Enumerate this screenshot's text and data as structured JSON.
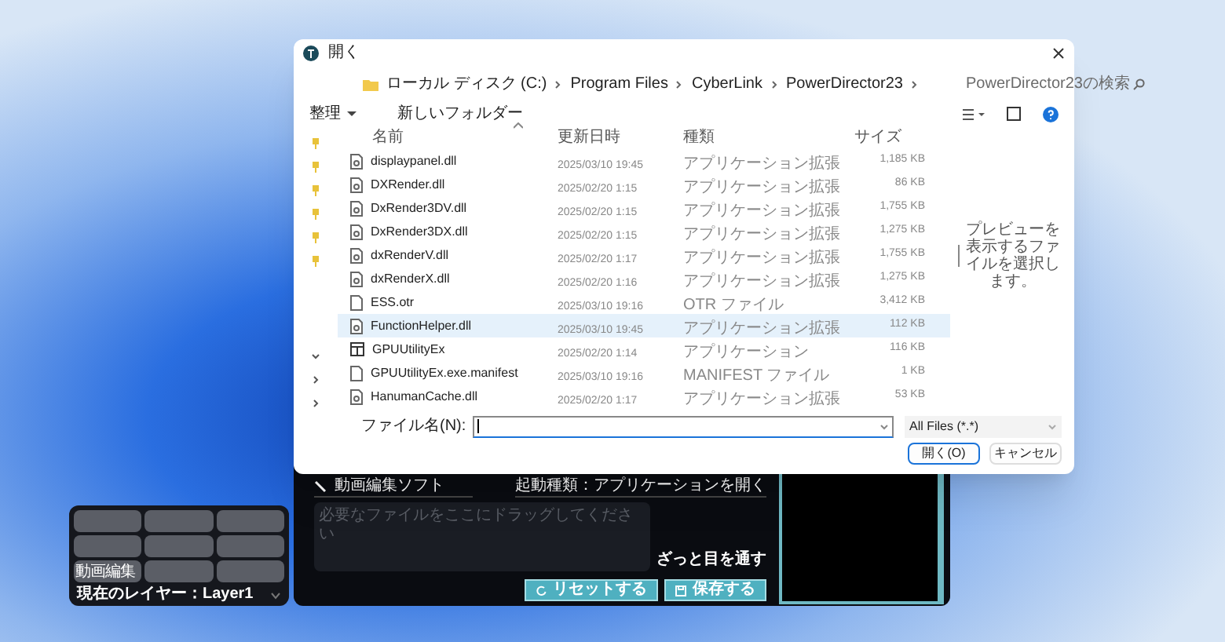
{
  "dialog": {
    "title": "開く",
    "path": [
      "ローカル ディスク (C:)",
      "Program Files",
      "CyberLink",
      "PowerDirector23"
    ],
    "search_placeholder": "PowerDirector23の検索",
    "toolbar": {
      "organize": "整理",
      "new_folder": "新しいフォルダー"
    },
    "columns": [
      "名前",
      "更新日時",
      "種類",
      "サイズ"
    ],
    "files": [
      {
        "name": "displaypanel.dll",
        "date": "2025/03/10 19:45",
        "type": "アプリケーション拡張",
        "size": "1,185 KB",
        "kind": "dll",
        "highlighted": false
      },
      {
        "name": "DXRender.dll",
        "date": "2025/02/20 1:15",
        "type": "アプリケーション拡張",
        "size": "86 KB",
        "kind": "dll",
        "highlighted": false
      },
      {
        "name": "DxRender3DV.dll",
        "date": "2025/02/20 1:15",
        "type": "アプリケーション拡張",
        "size": "1,755 KB",
        "kind": "dll",
        "highlighted": false
      },
      {
        "name": "DxRender3DX.dll",
        "date": "2025/02/20 1:15",
        "type": "アプリケーション拡張",
        "size": "1,275 KB",
        "kind": "dll",
        "highlighted": false
      },
      {
        "name": "dxRenderV.dll",
        "date": "2025/02/20 1:17",
        "type": "アプリケーション拡張",
        "size": "1,755 KB",
        "kind": "dll",
        "highlighted": false
      },
      {
        "name": "dxRenderX.dll",
        "date": "2025/02/20 1:16",
        "type": "アプリケーション拡張",
        "size": "1,275 KB",
        "kind": "dll",
        "highlighted": false
      },
      {
        "name": "ESS.otr",
        "date": "2025/03/10 19:16",
        "type": "OTR ファイル",
        "size": "3,412 KB",
        "kind": "doc",
        "highlighted": false
      },
      {
        "name": "FunctionHelper.dll",
        "date": "2025/03/10 19:45",
        "type": "アプリケーション拡張",
        "size": "112 KB",
        "kind": "dll",
        "highlighted": true
      },
      {
        "name": "GPUUtilityEx",
        "date": "2025/02/20 1:14",
        "type": "アプリケーション",
        "size": "116 KB",
        "kind": "app",
        "highlighted": false
      },
      {
        "name": "GPUUtilityEx.exe.manifest",
        "date": "2025/03/10 19:16",
        "type": "MANIFEST ファイル",
        "size": "1 KB",
        "kind": "doc",
        "highlighted": false
      },
      {
        "name": "HanumanCache.dll",
        "date": "2025/02/20 1:17",
        "type": "アプリケーション拡張",
        "size": "53 KB",
        "kind": "dll",
        "highlighted": false
      }
    ],
    "preview_hint": "プレビューを表示するファイルを選択します。",
    "filename_label": "ファイル名(N):",
    "file_type": "All Files (*.*)",
    "buttons": [
      {
        "label": "開く(O)",
        "kind": "primary"
      },
      {
        "label": "キャンセル",
        "kind": "normal"
      }
    ]
  },
  "app_panel": {
    "title": "動画編集ソフト",
    "launch_type": "起動種類：アプリケーションを開く",
    "drop_placeholder": "必要なファイルをここにドラッグしてください",
    "skim": "ざっと目を通す",
    "buttons": [
      {
        "label": "リセットする",
        "kind": "reset"
      },
      {
        "label": "保存する",
        "kind": "save"
      }
    ]
  },
  "layer_widget": {
    "tiles": [
      {
        "kind": "empty"
      },
      {
        "kind": "empty"
      },
      {
        "kind": "empty"
      },
      {
        "kind": "empty"
      },
      {
        "kind": "empty"
      },
      {
        "kind": "empty"
      },
      {
        "kind": "label",
        "label": "動画編集"
      },
      {
        "kind": "empty"
      },
      {
        "kind": "empty"
      }
    ],
    "current_layer": "現在のレイヤー：Layer1"
  }
}
